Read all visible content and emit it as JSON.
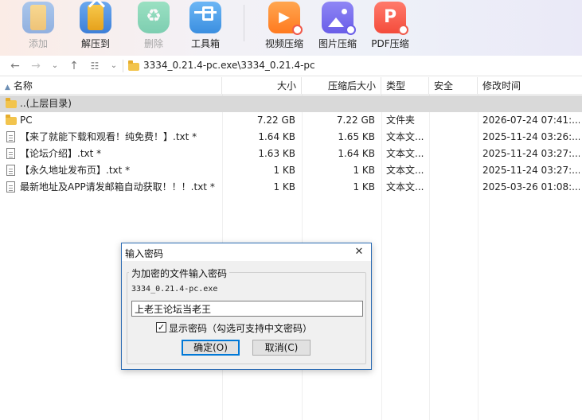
{
  "toolbar": {
    "items": [
      {
        "label": "添加",
        "icon": "add-archive-icon",
        "enabled": false
      },
      {
        "label": "解压到",
        "icon": "extract-icon",
        "enabled": true
      },
      {
        "label": "删除",
        "icon": "recycle-delete-icon",
        "enabled": false
      },
      {
        "label": "工具箱",
        "icon": "toolbox-icon",
        "enabled": true
      },
      {
        "label": "视频压缩",
        "icon": "video-compress-icon",
        "enabled": true
      },
      {
        "label": "图片压缩",
        "icon": "image-compress-icon",
        "enabled": true
      },
      {
        "label": "PDF压缩",
        "icon": "pdf-compress-icon",
        "enabled": true
      }
    ]
  },
  "address": {
    "path": "3334_0.21.4-pc.exe\\3334_0.21.4-pc"
  },
  "columns": {
    "name": "名称",
    "size": "大小",
    "packed": "压缩后大小",
    "type": "类型",
    "security": "安全",
    "modified": "修改时间"
  },
  "rows": [
    {
      "name": "..(上层目录)",
      "size": "",
      "packed": "",
      "type": "",
      "modified": "",
      "kind": "folder",
      "selected": true
    },
    {
      "name": "PC",
      "size": "7.22 GB",
      "packed": "7.22 GB",
      "type": "文件夹",
      "modified": "2026-07-24 07:41:...",
      "kind": "folder",
      "selected": false
    },
    {
      "name": "【来了就能下载和观看！纯免费！】.txt *",
      "size": "1.64 KB",
      "packed": "1.65 KB",
      "type": "文本文...",
      "modified": "2025-11-24 03:26:...",
      "kind": "file",
      "selected": false
    },
    {
      "name": "【论坛介绍】.txt *",
      "size": "1.63 KB",
      "packed": "1.64 KB",
      "type": "文本文...",
      "modified": "2025-11-24 03:27:...",
      "kind": "file",
      "selected": false
    },
    {
      "name": "【永久地址发布页】.txt *",
      "size": "1 KB",
      "packed": "1 KB",
      "type": "文本文...",
      "modified": "2025-11-24 03:27:...",
      "kind": "file",
      "selected": false
    },
    {
      "name": "最新地址及APP请发邮箱自动获取！！！.txt *",
      "size": "1 KB",
      "packed": "1 KB",
      "type": "文本文...",
      "modified": "2025-03-26 01:08:...",
      "kind": "file",
      "selected": false
    }
  ],
  "dialog": {
    "title": "输入密码",
    "close": "✕",
    "group_label": "为加密的文件输入密码",
    "filename": "3334_0.21.4-pc.exe",
    "password_value": "上老王论坛当老王",
    "show_password_checked": true,
    "show_password_label": "显示密码（勾选可支持中文密码）",
    "ok_label": "确定(O)",
    "cancel_label": "取消(C)"
  },
  "colors": {
    "dialog_border": "#2e6db4",
    "selected_row": "#d9d9d9",
    "default_button_border": "#0078d7"
  }
}
